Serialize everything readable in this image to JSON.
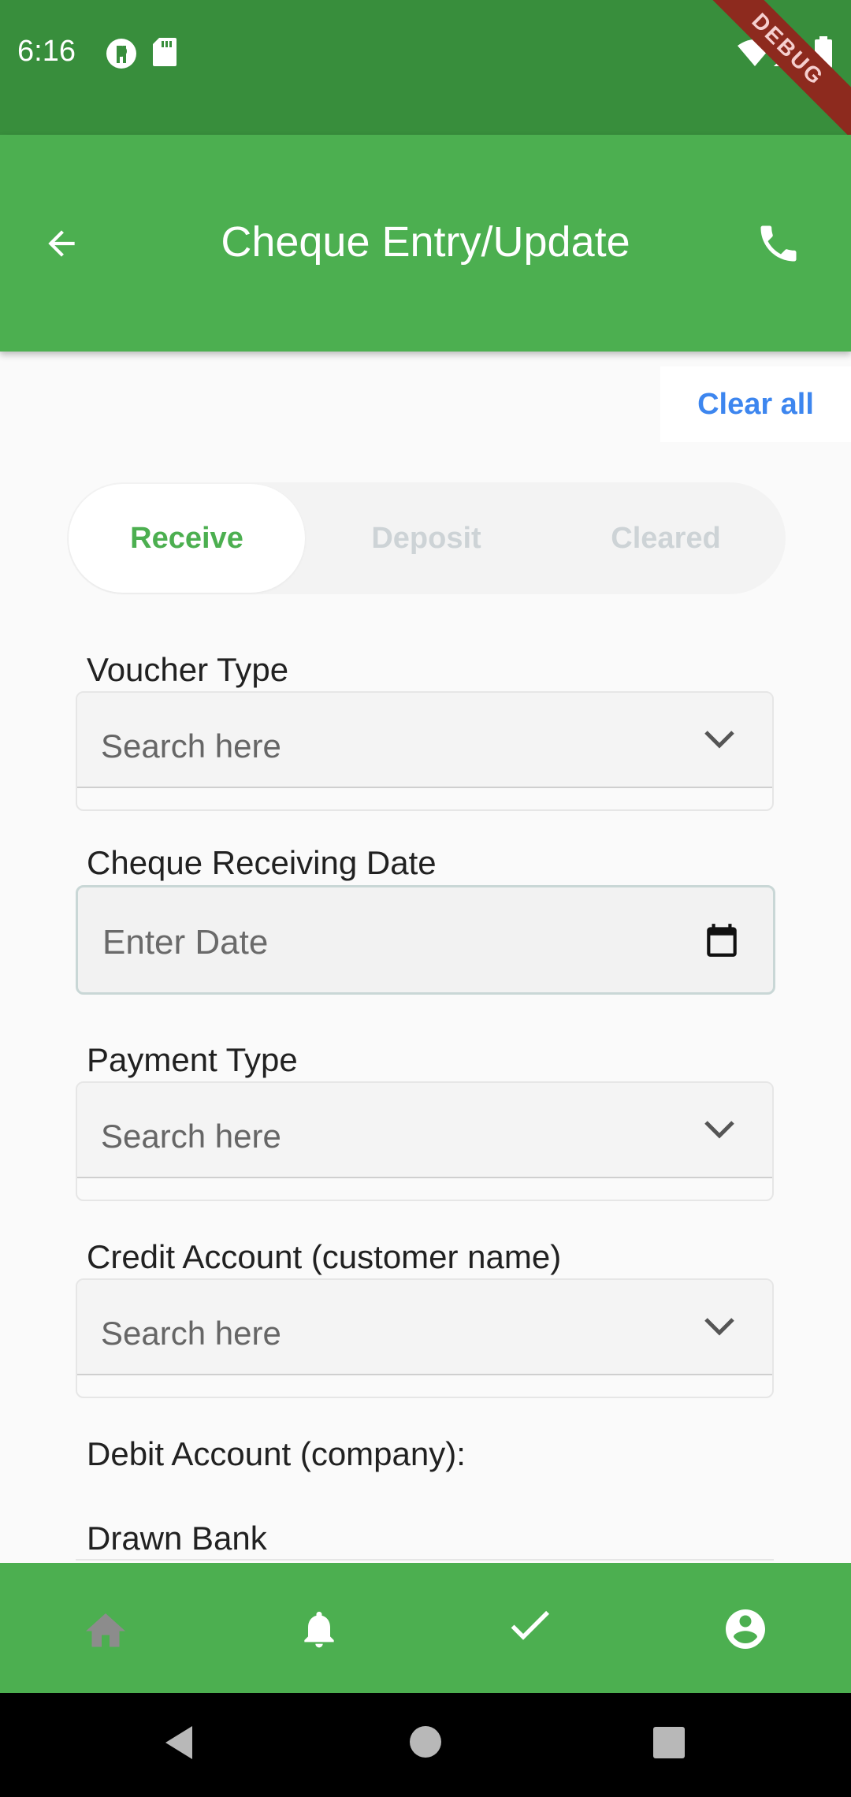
{
  "status_bar": {
    "time": "6:16",
    "debug_banner": "DEBUG",
    "icons": [
      "media-icon",
      "sd-card-icon",
      "wifi-icon",
      "signal-icon",
      "battery-icon"
    ]
  },
  "app_bar": {
    "title": "Cheque Entry/Update",
    "back_icon": "arrow-left-icon",
    "call_icon": "phone-icon"
  },
  "actions": {
    "clear_all": "Clear all"
  },
  "tabs": [
    {
      "label": "Receive",
      "active": true
    },
    {
      "label": "Deposit",
      "active": false
    },
    {
      "label": "Cleared",
      "active": false
    }
  ],
  "form": {
    "voucher_type": {
      "label": "Voucher Type",
      "placeholder": "Search here"
    },
    "cheque_receiving_date": {
      "label": "Cheque Receiving Date",
      "placeholder": "Enter Date"
    },
    "payment_type": {
      "label": "Payment Type",
      "placeholder": "Search here"
    },
    "credit_account": {
      "label": "Credit Account (customer name)",
      "placeholder": "Search here"
    },
    "debit_account": {
      "label": "Debit Account (company):"
    },
    "drawn_bank": {
      "label": "Drawn Bank"
    }
  },
  "bottom_nav": {
    "items": [
      "home-icon",
      "bell-icon",
      "check-icon",
      "account-icon"
    ]
  },
  "colors": {
    "status_bar": "#388e3c",
    "primary": "#4caf50",
    "link_blue": "#3d86ef",
    "tab_inactive": "#cdd3d6"
  }
}
